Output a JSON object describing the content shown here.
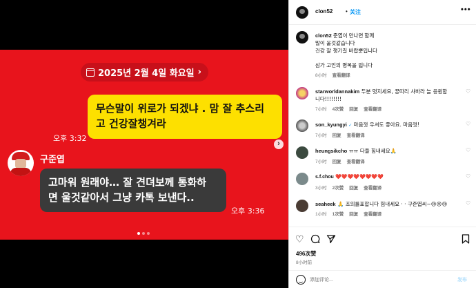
{
  "post": {
    "date_label": "2025년 2월 4일 화요일",
    "message_right": {
      "line1": "무슨말이 위로가 되겠냐 . 맘 잘 추스리",
      "line2": "고 건강잘챙겨라",
      "time": "오후 3:32"
    },
    "sender_name": "구준엽",
    "message_left": {
      "line1": "고마워 원래야… 잘 견뎌보께 통화하",
      "line2": "면 울것같아서 그냥 카톡 보낸다..",
      "time": "오후 3:36"
    },
    "colors": {
      "background": "#e8141c",
      "bubble_yellow": "#fde000",
      "bubble_dark": "#3a3a3a"
    }
  },
  "header": {
    "username": "clon52",
    "separator": "•",
    "follow_label": "关注",
    "more_label": "•••"
  },
  "caption": {
    "username": "clon52",
    "line1": "준엽이 만나면 함께",
    "line2": "많이 울것같습니다",
    "line3": "건강 잘 챙기길 바랍뿐입니다",
    "line4": "삼가 고인의 명복을 빕니다",
    "time": "8小时",
    "translate": "查看翻译"
  },
  "comments": [
    {
      "username": "starworldannakim",
      "text": "두분 멋지세요, 꿍따리 샤바라 늘 응원합",
      "text2": "니다!!!!!!!!",
      "time": "7小时",
      "likes": "4次赞",
      "reply": "回复",
      "translate": "查看翻译"
    },
    {
      "username": "son_kyungyi",
      "verified": "✓",
      "text": "마음껏 우셔도 좋아요. 마음껏!",
      "time": "7小时",
      "likes": "",
      "reply": "回复",
      "translate": "查看翻译"
    },
    {
      "username": "heungsikcho",
      "text": "ㅠㅠ 다들 힘내세요🙏",
      "time": "7小时",
      "likes": "",
      "reply": "回复",
      "translate": "查看翻译"
    },
    {
      "username": "s.f.chou",
      "text": "❤️❤️❤️❤️❤️❤️❤️❤️",
      "time": "3小时",
      "likes": "2次赞",
      "reply": "回复",
      "translate": "查看翻译"
    },
    {
      "username": "seaheek",
      "text": "🙏 조의를표합니다 힘내세요 · · 구준엽씨~😢😢😢",
      "time": "1小时",
      "likes": "1次赞",
      "reply": "回复",
      "translate": "查看翻译"
    }
  ],
  "actions": {
    "likes": "496次赞",
    "time_ago": "8小时前",
    "comment_placeholder": "添加评论...",
    "post_label": "发布"
  }
}
